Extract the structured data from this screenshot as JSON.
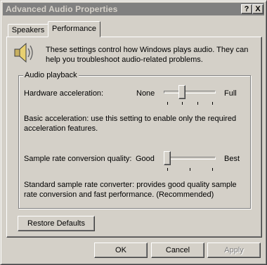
{
  "window": {
    "title": "Advanced Audio Properties",
    "help_glyph": "?",
    "close_glyph": "X"
  },
  "tabs": [
    {
      "label": "Speakers",
      "selected": false
    },
    {
      "label": "Performance",
      "selected": true
    }
  ],
  "panel": {
    "icon": "speaker-icon",
    "intro": "These settings control how Windows plays audio. They can help you troubleshoot audio-related problems.",
    "group_label": "Audio playback",
    "hardware_acceleration": {
      "label": "Hardware acceleration:",
      "min_label": "None",
      "max_label": "Full",
      "position": 1,
      "ticks": 4,
      "description": "Basic acceleration: use this setting to enable only the required acceleration features."
    },
    "sample_rate": {
      "label": "Sample rate conversion quality:",
      "min_label": "Good",
      "max_label": "Best",
      "position": 0,
      "ticks": 3,
      "description": "Standard sample rate converter: provides good quality sample rate conversion and fast performance. (Recommended)"
    }
  },
  "buttons": {
    "restore_defaults": "Restore Defaults",
    "ok": "OK",
    "cancel": "Cancel",
    "apply": "Apply"
  },
  "colors": {
    "face": "#d4d0c8",
    "titlebar_inactive": "#808080",
    "disabled_text": "#808080"
  }
}
